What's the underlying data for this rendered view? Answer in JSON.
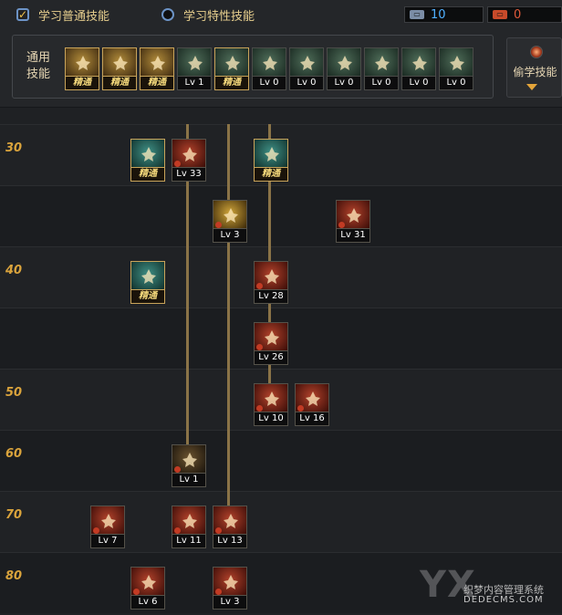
{
  "tabs": [
    {
      "label": "学习普通技能",
      "selected": true
    },
    {
      "label": "学习特性技能",
      "selected": false
    }
  ],
  "points": [
    {
      "icon": "sp-point-icon",
      "value": "10",
      "color": "#4fb0ff"
    },
    {
      "icon": "tp-point-icon",
      "value": "0",
      "color": "#e05a3a"
    }
  ],
  "general": {
    "label": "通用技能",
    "skills": [
      {
        "icon": "reclining-figure-icon",
        "label": "精通",
        "mastered": true
      },
      {
        "icon": "leaping-figure-icon",
        "label": "精通",
        "mastered": true
      },
      {
        "icon": "running-figure-icon",
        "label": "精通",
        "mastered": true
      },
      {
        "icon": "winged-emblem-icon",
        "label": "Lv 1",
        "mastered": false
      },
      {
        "icon": "crosshair-icon",
        "label": "精通",
        "mastered": true
      },
      {
        "icon": "target-burst-icon",
        "label": "Lv 0",
        "mastered": false
      },
      {
        "icon": "dash-figure-icon",
        "label": "Lv 0",
        "mastered": false
      },
      {
        "icon": "throw-figure-icon",
        "label": "Lv 0",
        "mastered": false
      },
      {
        "icon": "eye-ring-icon",
        "label": "Lv 0",
        "mastered": false
      },
      {
        "icon": "strong-figure-icon",
        "label": "Lv 0",
        "mastered": false
      },
      {
        "icon": "climb-figure-icon",
        "label": "Lv 0",
        "mastered": false
      }
    ]
  },
  "steal": {
    "label": "偷学技能",
    "icon": "steal-orb-icon"
  },
  "tree": {
    "levels": [
      "30",
      "",
      "40",
      "",
      "50",
      "60",
      "70",
      "80"
    ],
    "skills": [
      {
        "row": 0,
        "col": 1,
        "label": "精通",
        "style": "gr",
        "mastered": true,
        "icon": "rifle-icon"
      },
      {
        "row": 0,
        "col": 2,
        "label": "Lv 33",
        "style": "rd",
        "mastered": false,
        "icon": "cannon-icon"
      },
      {
        "row": 0,
        "col": 3,
        "label": "精通",
        "style": "gr",
        "mastered": true,
        "icon": "gear-target-icon"
      },
      {
        "row": 1,
        "col": "2.5",
        "label": "Lv 3",
        "style": "yl",
        "mastered": false,
        "icon": "ammo-icon"
      },
      {
        "row": 1,
        "col": 5,
        "label": "Lv 31",
        "style": "rd",
        "mastered": false,
        "icon": "swirl-icon"
      },
      {
        "row": 2,
        "col": 1,
        "label": "精通",
        "style": "gr",
        "mastered": true,
        "icon": "lightning-icon"
      },
      {
        "row": 2,
        "col": 3,
        "label": "Lv 28",
        "style": "rd",
        "mastered": false,
        "icon": "explosion-icon"
      },
      {
        "row": 3,
        "col": 3,
        "label": "Lv 26",
        "style": "rd",
        "mastered": false,
        "icon": "fireball-icon"
      },
      {
        "row": 4,
        "col": 3,
        "label": "Lv 10",
        "style": "rd",
        "mastered": false,
        "icon": "flame-pillar-icon"
      },
      {
        "row": 4,
        "col": 4,
        "label": "Lv 16",
        "style": "rd",
        "mastered": false,
        "icon": "sentry-icon"
      },
      {
        "row": 5,
        "col": 2,
        "label": "Lv 1",
        "style": "dk",
        "mastered": false,
        "icon": "sparkles-icon"
      },
      {
        "row": 6,
        "col": 0,
        "label": "Lv 7",
        "style": "rd",
        "mastered": false,
        "icon": "grenade-icon"
      },
      {
        "row": 6,
        "col": 2,
        "label": "Lv 11",
        "style": "rd",
        "mastered": false,
        "icon": "blast-figure-icon"
      },
      {
        "row": 6,
        "col": "2.5",
        "label": "Lv 13",
        "style": "rd",
        "mastered": false,
        "icon": "bullets-icon"
      },
      {
        "row": 7,
        "col": 1,
        "label": "Lv 6",
        "style": "rd",
        "mastered": false,
        "icon": "laser-rifle-icon"
      },
      {
        "row": 7,
        "col": "2.5",
        "label": "Lv 3",
        "style": "rd",
        "mastered": false,
        "icon": "orb-blast-icon"
      }
    ]
  },
  "watermark": {
    "big": "YX",
    "cn": "织梦内容管理系统",
    "en": "DEDECMS.COM"
  }
}
